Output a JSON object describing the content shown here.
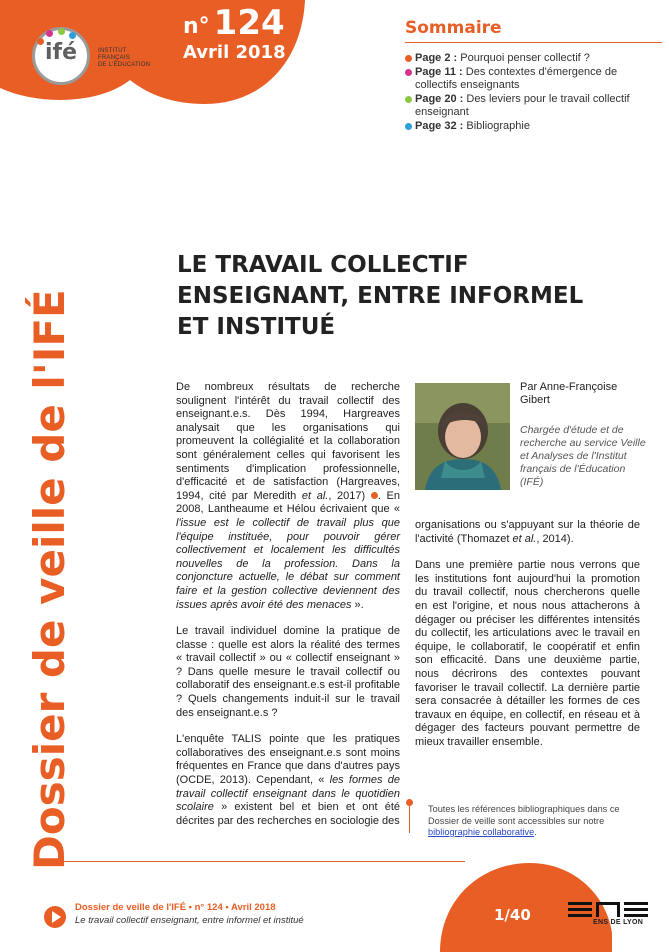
{
  "header": {
    "issue_prefix": "n°",
    "issue_number": "124",
    "issue_date": "Avril 2018",
    "logo_text": "ifé",
    "institute_lines": [
      "INSTITUT",
      "FRANÇAIS",
      "DE L'ÉDUCATION"
    ]
  },
  "sommaire": {
    "title": "Sommaire",
    "items": [
      {
        "page": "Page 2 :",
        "text": "Pourquoi penser collectif ?",
        "color": "#e85e24"
      },
      {
        "page": "Page 11 :",
        "text": "Des contextes d'émergence de collectifs enseignants",
        "color": "#d6338f"
      },
      {
        "page": "Page 20 :",
        "text": "Des leviers pour le travail collectif enseignant",
        "color": "#8dc63f"
      },
      {
        "page": "Page 32 :",
        "text": "Bibliographie",
        "color": "#2e9fd8"
      }
    ]
  },
  "vertical_title": "Dossier de veille de l'IFÉ",
  "article": {
    "title_lines": [
      "LE TRAVAIL COLLECTIF",
      "ENSEIGNANT, ENTRE INFORMEL",
      "ET INSTITUÉ"
    ],
    "author": "Par Anne-Françoise Gibert",
    "author_role": "Chargée d'étude et de recherche au service Veille et Analyses de l'Institut français de l'Éducation (IFÉ)",
    "col1": {
      "p1_a": "De nombreux résultats de recherche soulignent l'intérêt du travail collectif des enseignant.e.s. Dès 1994, Hargreaves analysait que les organisations qui promeuvent la collégialité et la collaboration sont généralement celles qui favorisent les sentiments d'implication professionnelle, d'efficacité et de satisfaction (Hargreaves, 1994, cité par Meredith ",
      "p1_etal": "et al.",
      "p1_b": ", 2017)",
      "p1_c": ". En 2008, Lantheaume et Hélou écrivaient que « ",
      "p1_quote": "l'issue est le collectif de travail plus que l'équipe instituée, pour pouvoir gérer collectivement et localement les difficultés nouvelles de la profession. Dans la conjoncture actuelle, le débat sur comment faire et la gestion collective deviennent des issues après avoir été des menaces",
      "p1_end": " ».",
      "p2": "Le travail individuel domine la pratique de classe : quelle est alors la réalité des termes « travail collectif » ou « collectif enseignant » ? Dans quelle mesure le travail collectif ou collaboratif des enseignant.e.s est-il profitable ? Quels changements induit-il sur le travail des enseignant.e.s ?",
      "p3_a": "L'enquête TALIS pointe que les pratiques collaboratives des enseignant.e.s sont moins fréquentes en France que dans d'autres pays (OCDE, 2013). Cependant, « ",
      "p3_quote": "les formes de travail collectif enseignant dans le quotidien scolaire",
      "p3_b": " » existent bel et bien et ont été décrites par des recherches en sociologie des"
    },
    "col2": {
      "p1_a": "organisations ou s'appuyant sur la théorie de l'activité (Thomazet ",
      "p1_etal": "et al.",
      "p1_b": ", 2014).",
      "p2": "Dans une première partie nous verrons que les institutions font aujourd'hui la promotion du travail collectif, nous chercherons quelle en est l'origine, et nous nous attacherons à dégager ou préciser les différentes intensités du collectif, les articulations avec le travail en équipe, le collaboratif, le coopératif et enfin son efficacité. Dans une deuxième partie, nous décrirons des contextes pouvant favoriser le travail collectif. La dernière partie sera consacrée à détailler les formes de ces travaux en équipe, en collectif, en réseau et à dégager des facteurs pouvant permettre de mieux travailler ensemble."
    },
    "note": {
      "text": "Toutes les références bibliographiques dans ce Dossier de veille sont accessibles sur notre ",
      "link": "bibliographie collaborative",
      "end": "."
    }
  },
  "footer": {
    "line1": "Dossier de veille de l'IFÉ • n° 124 • Avril 2018",
    "line2": "Le travail collectif enseignant, entre informel et institué",
    "page": "1/40",
    "ens_sub": "ENS DE LYON"
  },
  "colors": {
    "accent": "#e85e24"
  }
}
